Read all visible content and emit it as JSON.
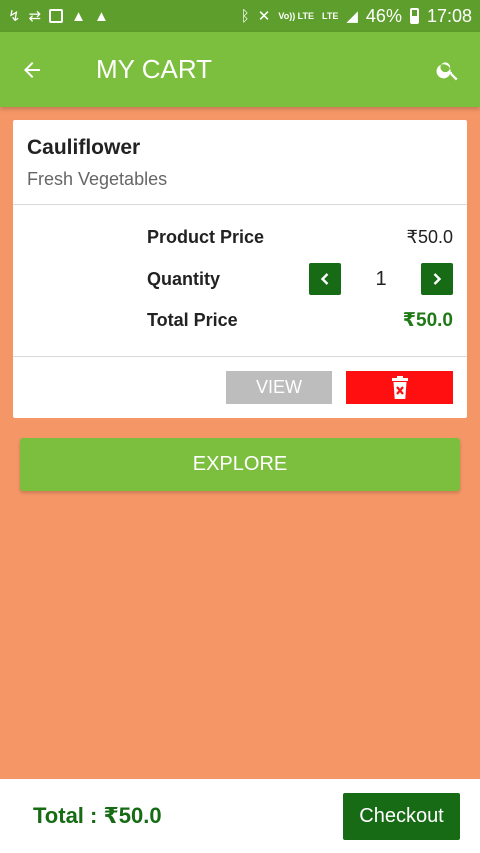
{
  "status_bar": {
    "battery": "46%",
    "time": "17:08",
    "left_icons": [
      "missed-call-icon",
      "sync-icon",
      "image-icon",
      "warning-icon",
      "warning-icon"
    ],
    "right_icons": [
      "bluetooth-icon",
      "mute-icon",
      "volte-icon",
      "lte-icon",
      "signal-icon",
      "battery-icon"
    ],
    "volte_label": "Vo)) LTE",
    "lte_label": "LTE"
  },
  "app_bar": {
    "title": "MY CART",
    "back_icon": "back-arrow-icon",
    "search_icon": "search-icon"
  },
  "cart_item": {
    "name": "Cauliflower",
    "category": "Fresh Vegetables",
    "price_label": "Product Price",
    "price_value": "₹50.0",
    "quantity_label": "Quantity",
    "quantity_value": "1",
    "total_label": "Total Price",
    "total_value": "₹50.0",
    "view_label": "VIEW",
    "delete_icon": "trash-icon"
  },
  "explore_label": "EXPLORE",
  "footer": {
    "total_text": "Total : ₹50.0",
    "checkout_label": "Checkout"
  },
  "colors": {
    "page_background": "#f59667",
    "status_bar": "#5e9e2c",
    "app_bar": "#7cbf3f",
    "dark_green": "#176b15",
    "delete_red": "#ff0f0f",
    "view_gray": "#bdbdbd"
  }
}
